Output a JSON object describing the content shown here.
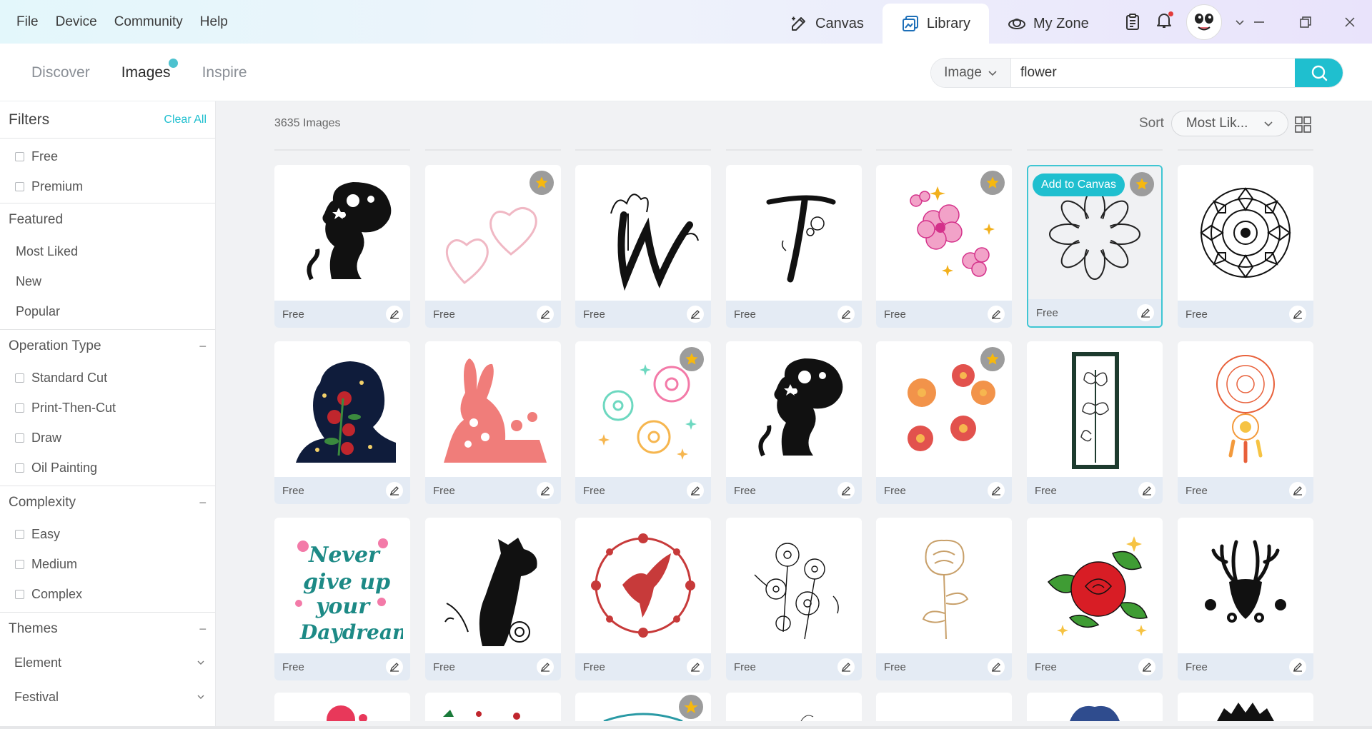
{
  "menu": [
    "File",
    "Device",
    "Community",
    "Help"
  ],
  "app_tabs": [
    {
      "label": "Canvas",
      "icon": "canvas-icon",
      "active": false
    },
    {
      "label": "Library",
      "icon": "library-icon",
      "active": true
    },
    {
      "label": "My Zone",
      "icon": "myzone-icon",
      "active": false
    }
  ],
  "subtabs": [
    {
      "label": "Discover",
      "active": false
    },
    {
      "label": "Images",
      "active": true
    },
    {
      "label": "Inspire",
      "active": false
    }
  ],
  "search": {
    "type": "Image",
    "value": "flower"
  },
  "filters": {
    "title": "Filters",
    "clear_all": "Clear All",
    "price": [
      "Free",
      "Premium"
    ],
    "featured": {
      "title": "Featured",
      "items": [
        "Most Liked",
        "New",
        "Popular"
      ]
    },
    "operation": {
      "title": "Operation Type",
      "items": [
        "Standard Cut",
        "Print-Then-Cut",
        "Draw",
        "Oil Painting"
      ]
    },
    "complexity": {
      "title": "Complexity",
      "items": [
        "Easy",
        "Medium",
        "Complex"
      ]
    },
    "themes": {
      "title": "Themes",
      "items": [
        "Element",
        "Festival"
      ]
    }
  },
  "results": {
    "count": "3635 Images",
    "sort_label": "Sort",
    "sort_value": "Most Lik..."
  },
  "card_label": "Free",
  "add_to_canvas": "Add to Canvas",
  "colors": {
    "accent": "#1fbfcf",
    "card_footer": "#e4ebf4",
    "star": "#f6b80f"
  },
  "cards": [
    {
      "art": "woman-silhouette",
      "premium": false,
      "selected": false
    },
    {
      "art": "two-hearts",
      "premium": true,
      "selected": false
    },
    {
      "art": "letter-w-iris",
      "premium": false,
      "selected": false
    },
    {
      "art": "letter-t-flower",
      "premium": false,
      "selected": false
    },
    {
      "art": "pink-flowers",
      "premium": true,
      "selected": false
    },
    {
      "art": "flower-outline",
      "premium": true,
      "selected": true
    },
    {
      "art": "mandala",
      "premium": false,
      "selected": false
    },
    {
      "art": "woman-roses",
      "premium": false,
      "selected": false
    },
    {
      "art": "bunny-flowers",
      "premium": false,
      "selected": false
    },
    {
      "art": "pastel-flowers",
      "premium": true,
      "selected": false
    },
    {
      "art": "woman-silhouette",
      "premium": false,
      "selected": false
    },
    {
      "art": "orange-flowers",
      "premium": true,
      "selected": false
    },
    {
      "art": "lily-panel",
      "premium": false,
      "selected": false
    },
    {
      "art": "dreamcatcher",
      "premium": false,
      "selected": false
    },
    {
      "art": "never-give-up-text",
      "premium": false,
      "selected": false
    },
    {
      "art": "giraffe-flowers",
      "premium": false,
      "selected": false
    },
    {
      "art": "bird-wreath",
      "premium": false,
      "selected": false
    },
    {
      "art": "line-flowers",
      "premium": false,
      "selected": false
    },
    {
      "art": "gold-peony",
      "premium": false,
      "selected": false
    },
    {
      "art": "red-rose",
      "premium": false,
      "selected": false
    },
    {
      "art": "deer-floral",
      "premium": false,
      "selected": false
    }
  ]
}
